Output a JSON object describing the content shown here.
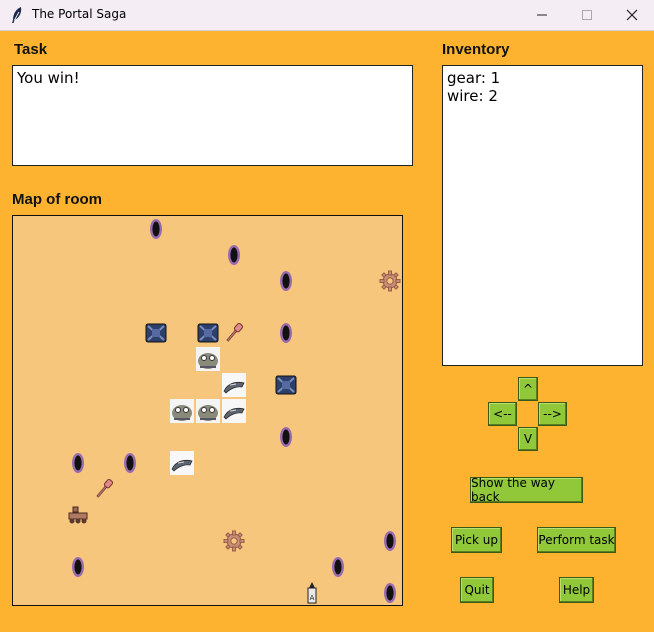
{
  "window": {
    "title": "The Portal Saga"
  },
  "task": {
    "label": "Task",
    "text": "You win!"
  },
  "inventory": {
    "label": "Inventory",
    "items": [
      "gear: 1",
      "wire: 2"
    ]
  },
  "map": {
    "label": "Map of room",
    "background": "#f5c67c",
    "portals": [
      {
        "col": 5,
        "row": 0
      },
      {
        "col": 8,
        "row": 1
      },
      {
        "col": 10,
        "row": 2
      },
      {
        "col": 10,
        "row": 4
      },
      {
        "col": 10,
        "row": 8
      },
      {
        "col": 2,
        "row": 9
      },
      {
        "col": 4,
        "row": 9
      },
      {
        "col": 14,
        "row": 12
      },
      {
        "col": 2,
        "row": 13
      },
      {
        "col": 12,
        "row": 13
      },
      {
        "col": 14,
        "row": 14
      }
    ],
    "gears": [
      {
        "col": 14,
        "row": 2
      },
      {
        "col": 8,
        "row": 12
      }
    ],
    "crates": [
      {
        "col": 5,
        "row": 4
      },
      {
        "col": 7,
        "row": 4
      },
      {
        "col": 10,
        "row": 6
      }
    ],
    "screwdrivers": [
      {
        "col": 8,
        "row": 4
      },
      {
        "col": 3,
        "row": 10
      }
    ],
    "creatures": [
      {
        "col": 7,
        "row": 5
      },
      {
        "col": 6,
        "row": 7
      },
      {
        "col": 7,
        "row": 7
      }
    ],
    "whales": [
      {
        "col": 8,
        "row": 6
      },
      {
        "col": 8,
        "row": 7
      },
      {
        "col": 6,
        "row": 9
      }
    ],
    "rover": {
      "col": 2,
      "row": 11
    },
    "beacon": {
      "col": 11,
      "row": 14
    }
  },
  "controls": {
    "up": "^",
    "left": "<--",
    "right": "-->",
    "down": "V",
    "show_way_back": "Show the way back",
    "pick_up": "Pick up",
    "perform_task": "Perform task",
    "quit": "Quit",
    "help": "Help"
  },
  "colors": {
    "window_bg": "#fdb32f",
    "button_bg": "#90c83a",
    "map_bg": "#f5c67c"
  }
}
